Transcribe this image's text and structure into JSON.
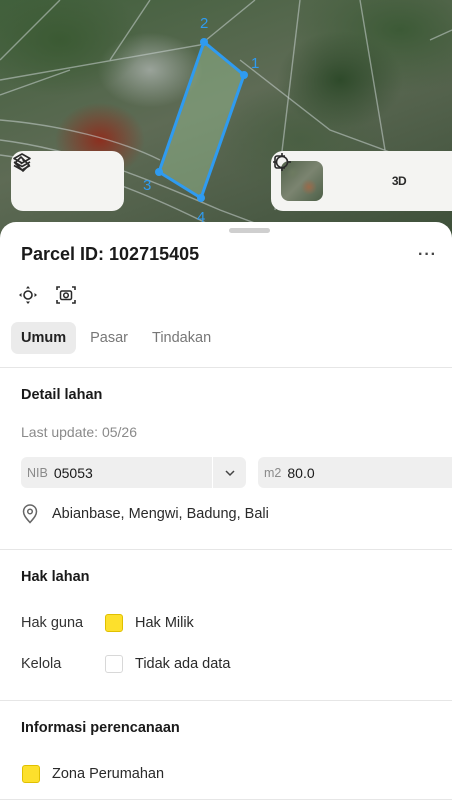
{
  "map": {
    "vertex_labels": [
      "2",
      "1",
      "3",
      "4"
    ],
    "boundary_color": "#2f9bf0",
    "controls_left": [
      {
        "icon": "layers-icon"
      },
      {
        "icon": "measure-icon"
      }
    ],
    "controls_right": [
      {
        "icon": "satellite-thumbnail"
      },
      {
        "icon": "locate-icon"
      },
      {
        "label": "3D"
      },
      {
        "icon": "frame-icon"
      }
    ]
  },
  "parcel": {
    "title": "Parcel ID: 102715405",
    "more_label": "···"
  },
  "tabs": [
    {
      "label": "Umum",
      "active": true
    },
    {
      "label": "Pasar",
      "active": false
    },
    {
      "label": "Tindakan",
      "active": false
    }
  ],
  "detail": {
    "heading": "Detail lahan",
    "last_update": "Last update: 05/26",
    "nib_label": "NIB",
    "nib_value": "05053",
    "area_label": "m2",
    "area_value": "80.0",
    "location": "Abianbase, Mengwi, Badung, Bali"
  },
  "hak": {
    "heading": "Hak lahan",
    "rows": [
      {
        "label": "Hak guna",
        "value": "Hak Milik",
        "swatch": "#fde02c"
      },
      {
        "label": "Kelola",
        "value": "Tidak ada data",
        "swatch": "#ffffff"
      }
    ]
  },
  "planning": {
    "heading": "Informasi perencanaan",
    "zone": "Zona Perumahan",
    "zone_color": "#fde02c"
  }
}
